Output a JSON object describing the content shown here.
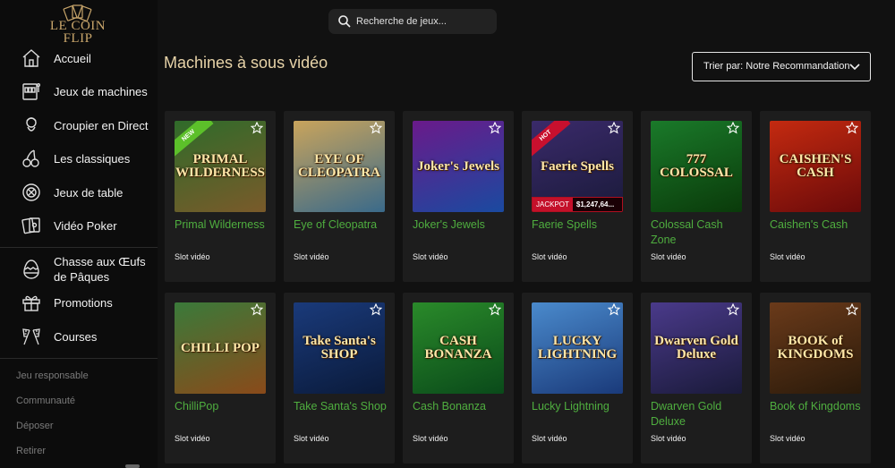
{
  "brand": {
    "logo_text": "LE COIN FLIP"
  },
  "search": {
    "placeholder": "Recherche de jeux..."
  },
  "sidebar": {
    "items": [
      {
        "label": "Accueil",
        "icon": "home-icon"
      },
      {
        "label": "Jeux de machines",
        "icon": "slot-machine-icon"
      },
      {
        "label": "Croupier en Direct",
        "icon": "dealer-icon"
      },
      {
        "label": "Les classiques",
        "icon": "cherries-icon"
      },
      {
        "label": "Jeux de table",
        "icon": "chip-icon"
      },
      {
        "label": "Vidéo Poker",
        "icon": "cards-icon"
      },
      {
        "label": "Chasse aux Œufs de Pâques",
        "icon": "easter-egg-icon"
      },
      {
        "label": "Promotions",
        "icon": "gift-icon"
      },
      {
        "label": "Courses",
        "icon": "racing-flags-icon"
      }
    ],
    "footer_links": [
      "Jeu responsable",
      "Communauté",
      "Déposer",
      "Retirer"
    ]
  },
  "main": {
    "title": "Machines à sous vidéo",
    "sort_label": "Trier par: Notre Recommandation"
  },
  "games": [
    {
      "name": "Primal Wilderness",
      "type": "Slot vidéo",
      "art": "PRIMAL WILDERNESS",
      "badge": "NEW",
      "colors": [
        "#2f6b2a",
        "#7a5a2a"
      ]
    },
    {
      "name": "Eye of Cleopatra",
      "type": "Slot vidéo",
      "art": "EYE OF CLEOPATRA",
      "colors": [
        "#c9a45c",
        "#3a6a8a"
      ]
    },
    {
      "name": "Joker's Jewels",
      "type": "Slot vidéo",
      "art": "Joker's Jewels",
      "colors": [
        "#6a1a8a",
        "#1a4aa0"
      ]
    },
    {
      "name": "Faerie Spells",
      "type": "Slot vidéo",
      "art": "Faerie Spells",
      "badge": "HOT",
      "jackpot_label": "JACKPOT",
      "jackpot_value": "$1,247,64...",
      "colors": [
        "#3a2a6a",
        "#1a1a3a"
      ]
    },
    {
      "name": "Colossal Cash Zone",
      "type": "Slot vidéo",
      "art": "777 COLOSSAL",
      "colors": [
        "#1a7a2a",
        "#0a3a0a"
      ]
    },
    {
      "name": "Caishen's Cash",
      "type": "Slot vidéo",
      "art": "CAISHEN'S CASH",
      "colors": [
        "#c42a10",
        "#6a0a0a"
      ]
    },
    {
      "name": "ChilliPop",
      "type": "Slot vidéo",
      "art": "CHILLI POP",
      "colors": [
        "#3a7a3a",
        "#8a4a1a"
      ]
    },
    {
      "name": "Take Santa's Shop",
      "type": "Slot vidéo",
      "art": "Take Santa's SHOP",
      "colors": [
        "#1a3a7a",
        "#0a1a3a"
      ]
    },
    {
      "name": "Cash Bonanza",
      "type": "Slot vidéo",
      "art": "CASH BONANZA",
      "colors": [
        "#2a8a2a",
        "#0a4a1a"
      ]
    },
    {
      "name": "Lucky Lightning",
      "type": "Slot vidéo",
      "art": "LUCKY LIGHTNING",
      "colors": [
        "#4a8acc",
        "#1a3a7a"
      ]
    },
    {
      "name": "Dwarven Gold Deluxe",
      "type": "Slot vidéo",
      "art": "Dwarven Gold Deluxe",
      "colors": [
        "#4a3a8a",
        "#1a1a3a"
      ]
    },
    {
      "name": "Book of Kingdoms",
      "type": "Slot vidéo",
      "art": "BOOK of KINGDOMS",
      "colors": [
        "#6a3a1a",
        "#2a1a0a"
      ]
    }
  ],
  "colors": {
    "accent_title": "#e7d3a8",
    "game_name": "#4fae3f",
    "card_bg": "#1d1d1d",
    "page_bg": "#111111"
  }
}
